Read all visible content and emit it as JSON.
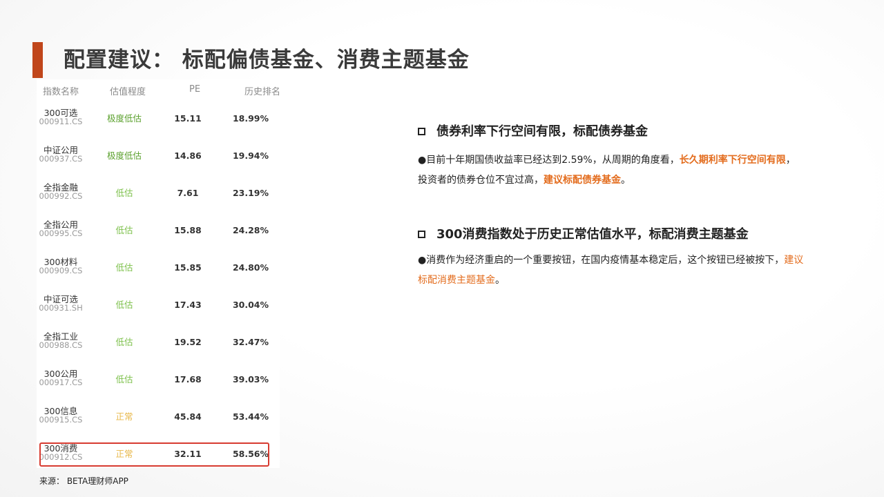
{
  "page": {
    "title": "配置建议：  标配偏债基金、消费主题基金",
    "accent_color": "#c0461b"
  },
  "table": {
    "headers": [
      "指数名称",
      "估值程度",
      "PE",
      "历史排名"
    ],
    "rows": [
      {
        "name": "300可选",
        "code": "000911.CS",
        "level": "极度低估",
        "level_color": "#5aa02c",
        "pe": "15.11",
        "rank": "18.99%"
      },
      {
        "name": "中证公用",
        "code": "000937.CS",
        "level": "极度低估",
        "level_color": "#5aa02c",
        "pe": "14.86",
        "rank": "19.94%"
      },
      {
        "name": "全指金融",
        "code": "000992.CS",
        "level": "低估",
        "level_color": "#7cc04a",
        "pe": "7.61",
        "rank": "23.19%"
      },
      {
        "name": "全指公用",
        "code": "000995.CS",
        "level": "低估",
        "level_color": "#7cc04a",
        "pe": "15.88",
        "rank": "24.28%"
      },
      {
        "name": "300材料",
        "code": "000909.CS",
        "level": "低估",
        "level_color": "#7cc04a",
        "pe": "15.85",
        "rank": "24.80%"
      },
      {
        "name": "中证可选",
        "code": "000931.SH",
        "level": "低估",
        "level_color": "#7cc04a",
        "pe": "17.43",
        "rank": "30.04%"
      },
      {
        "name": "全指工业",
        "code": "000988.CS",
        "level": "低估",
        "level_color": "#7cc04a",
        "pe": "19.52",
        "rank": "32.47%"
      },
      {
        "name": "300公用",
        "code": "000917.CS",
        "level": "低估",
        "level_color": "#7cc04a",
        "pe": "17.68",
        "rank": "39.03%"
      },
      {
        "name": "300信息",
        "code": "000915.CS",
        "level": "正常",
        "level_color": "#e8b84a",
        "pe": "45.84",
        "rank": "53.44%"
      },
      {
        "name": "300消费",
        "code": "000912.CS",
        "level": "正常",
        "level_color": "#e8b84a",
        "pe": "32.11",
        "rank": "58.56%"
      }
    ],
    "highlight_color": "#d73a2f",
    "source": "来源：  BETA理财师APP"
  },
  "sections": [
    {
      "heading": "债券利率下行空间有限，标配债券基金",
      "p1": "●目前十年期国债收益率已经达到2.59%，从周期的角度看，",
      "h1": "长久期利率下行空间有限",
      "p2": "，投资者的债券仓位不宜过高，",
      "h2": "建议标配债券基金",
      "p3": "。"
    },
    {
      "heading": "300消费指数处于历史正常估值水平，标配消费主题基金",
      "p1": "●消费作为经济重启的一个重要按钮，在国内疫情基本稳定后，这个按钮已经被按下，",
      "h1": "建议标配消费主题基金",
      "p2": "。"
    }
  ],
  "highlight_text_color": "#e36c1d"
}
